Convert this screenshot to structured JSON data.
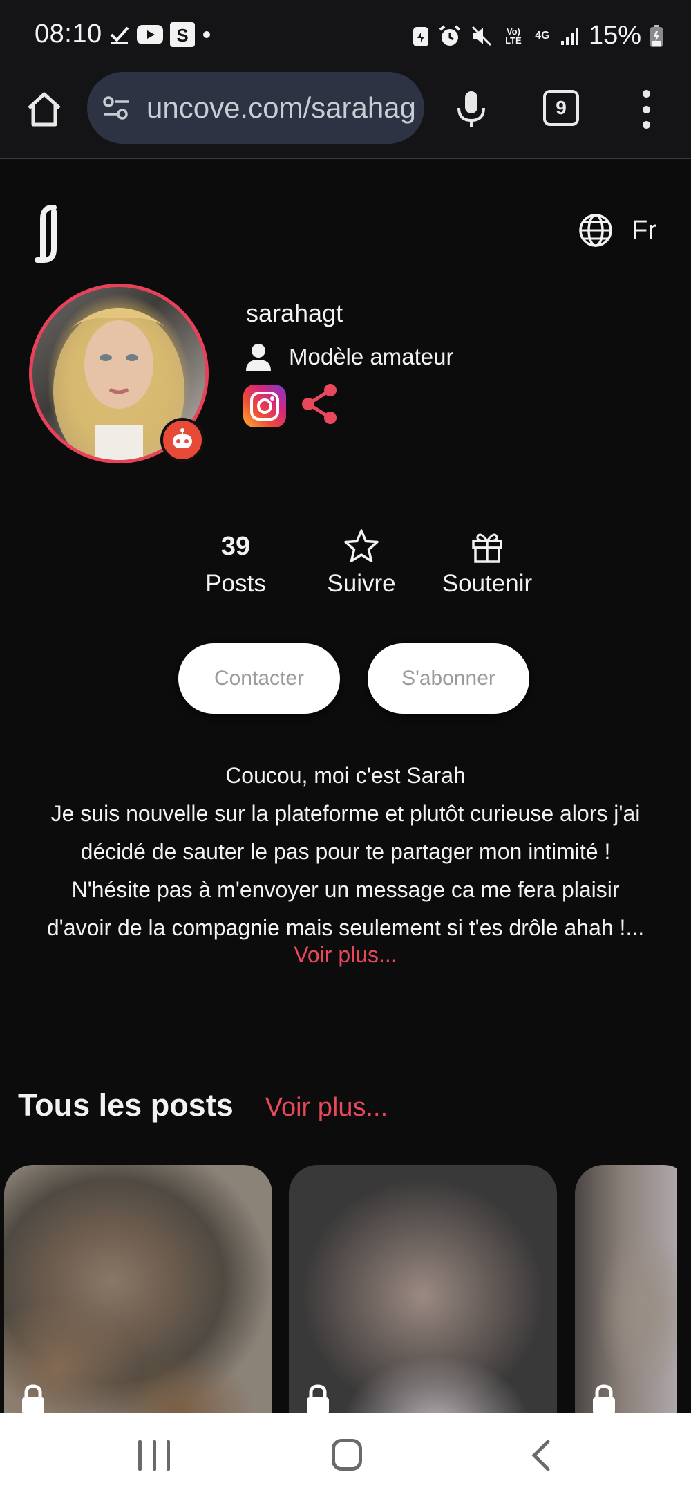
{
  "status_bar": {
    "time": "08:10",
    "battery": "15%",
    "network_top": "Vo) LTE",
    "network_gen": "4G"
  },
  "browser": {
    "url": "uncove.com/sarahagt",
    "tab_count": "9"
  },
  "header": {
    "language": "Fr"
  },
  "profile": {
    "username": "sarahagt",
    "role": "Modèle amateur"
  },
  "stats": {
    "posts_count": "39",
    "posts_label": "Posts",
    "follow_label": "Suivre",
    "support_label": "Soutenir"
  },
  "actions": {
    "contact_label": "Contacter",
    "subscribe_label": "S'abonner"
  },
  "bio": {
    "lines": [
      "Coucou, moi c'est Sarah",
      "Je suis nouvelle sur la plateforme et plutôt curieuse alors j'ai",
      "décidé de sauter le pas pour te partager mon intimité !",
      "N'hésite pas à m'envoyer un message ca me fera plaisir",
      "d'avoir de la compagnie mais seulement si t'es drôle ahah !..."
    ],
    "more_label": "Voir plus..."
  },
  "posts_section": {
    "title": "Tous les posts",
    "more_label": "Voir plus..."
  },
  "colors": {
    "accent": "#e8485c",
    "background": "#0c0c0d",
    "url_pill": "#2d3342"
  }
}
